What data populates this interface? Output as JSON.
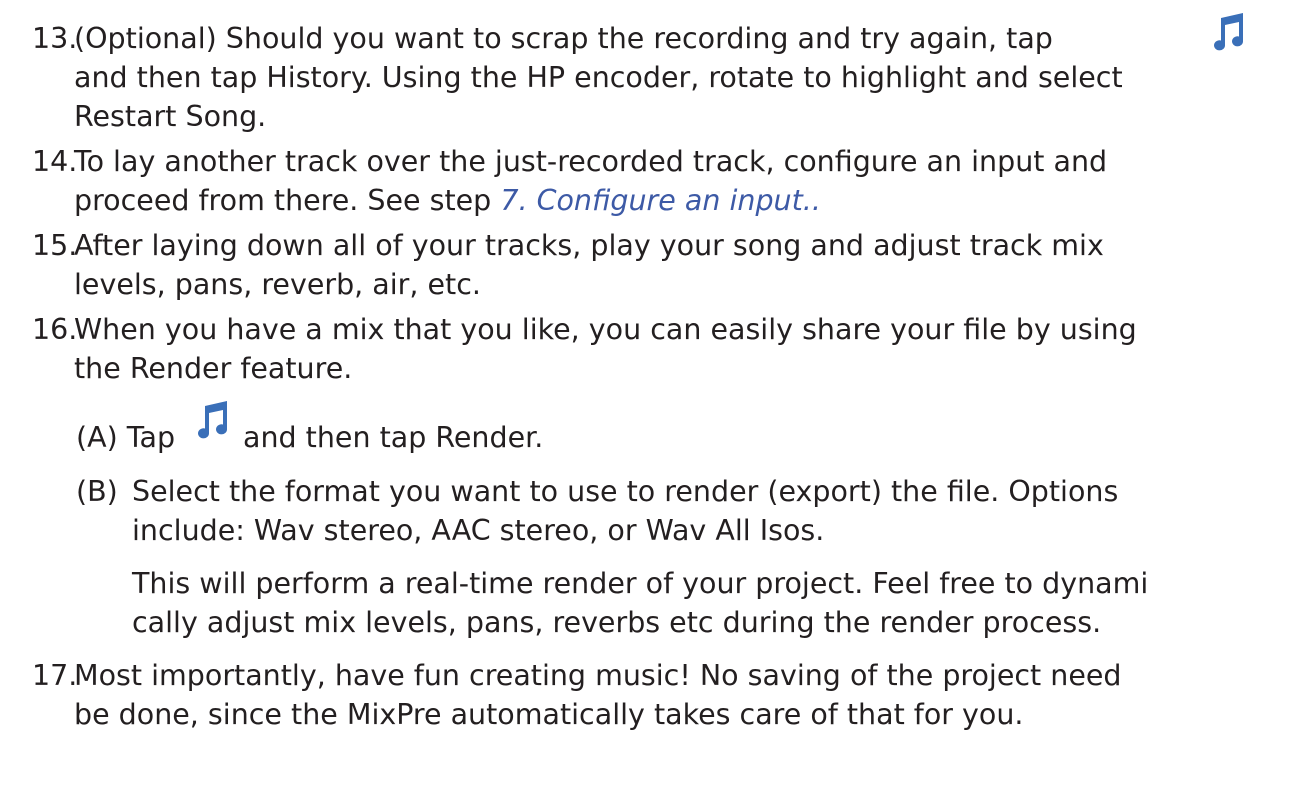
{
  "steps": [
    {
      "number": "13.",
      "line1": "(Optional) Should you want to scrap the recording and try again, tap",
      "line2": "and then tap History. Using the HP encoder, rotate to highlight and select",
      "line3": "Restart Song."
    },
    {
      "number": "14.",
      "line1": "To lay another track over the just-recorded track, configure an input and",
      "line2_prefix": "proceed from there. See step ",
      "link": "7. Configure an input.."
    },
    {
      "number": "15.",
      "line1": "After laying down all of your tracks, play your song and adjust track mix",
      "line2": "levels, pans, reverb, air, etc."
    },
    {
      "number": "16.",
      "line1": "When you have a mix that you like, you can easily share your file by using",
      "line2": "the Render feature.",
      "substeps": [
        {
          "label": "(A)",
          "pre": "Tap",
          "post": "and then tap Render."
        },
        {
          "label": "(B)",
          "line1": "Select the format you want to use to render (export) the file. Options",
          "line2": "include: Wav stereo, AAC stereo, or Wav All Isos.",
          "note_line1": "This will perform a real-time render of your project. Feel free to dynami",
          "note_line2": "cally adjust mix levels, pans, reverbs etc during the render process."
        }
      ]
    },
    {
      "number": "17.",
      "line1": "Most importantly, have fun creating music!  No saving of the project need",
      "line2": "be done, since the MixPre automatically takes care of that for you."
    }
  ],
  "icons": {
    "music": "music-note-icon",
    "color": "#3a6fb8"
  },
  "colors": {
    "text": "#231f20",
    "link": "#3d5aa6"
  }
}
